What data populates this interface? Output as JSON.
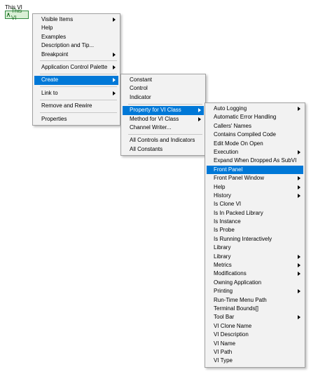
{
  "vi": {
    "label": "This VI",
    "constant_text": "This VI"
  },
  "context_menu": {
    "items": [
      {
        "label": "Visible Items",
        "submenu": true
      },
      {
        "label": "Help"
      },
      {
        "label": "Examples"
      },
      {
        "label": "Description and Tip..."
      },
      {
        "label": "Breakpoint",
        "submenu": true
      },
      {
        "label": "Application Control Palette",
        "submenu": true
      },
      {
        "label": "Create",
        "submenu": true,
        "selected": true
      },
      {
        "label": "Link to",
        "submenu": true
      },
      {
        "label": "Remove and Rewire"
      },
      {
        "label": "Properties"
      }
    ]
  },
  "create_menu": {
    "items": [
      {
        "label": "Constant"
      },
      {
        "label": "Control"
      },
      {
        "label": "Indicator"
      },
      {
        "label": "Property for VI Class",
        "submenu": true,
        "selected": true
      },
      {
        "label": "Method for VI Class",
        "submenu": true
      },
      {
        "label": "Channel Writer..."
      },
      {
        "label": "All Controls and Indicators"
      },
      {
        "label": "All Constants"
      }
    ]
  },
  "property_menu": {
    "items": [
      {
        "label": "Auto Logging",
        "submenu": true
      },
      {
        "label": "Automatic Error Handling"
      },
      {
        "label": "Callers' Names"
      },
      {
        "label": "Contains Compiled Code"
      },
      {
        "label": "Edit Mode On Open"
      },
      {
        "label": "Execution",
        "submenu": true
      },
      {
        "label": "Expand When Dropped As SubVI"
      },
      {
        "label": "Front Panel",
        "selected": true
      },
      {
        "label": "Front Panel Window",
        "submenu": true
      },
      {
        "label": "Help",
        "submenu": true
      },
      {
        "label": "History",
        "submenu": true
      },
      {
        "label": "Is Clone VI"
      },
      {
        "label": "Is In Packed Library"
      },
      {
        "label": "Is Instance"
      },
      {
        "label": "Is Probe"
      },
      {
        "label": "Is Running Interactively"
      },
      {
        "label": "Library"
      },
      {
        "label": "Library",
        "submenu": true
      },
      {
        "label": "Metrics",
        "submenu": true
      },
      {
        "label": "Modifications",
        "submenu": true
      },
      {
        "label": "Owning Application"
      },
      {
        "label": "Printing",
        "submenu": true
      },
      {
        "label": "Run-Time Menu Path"
      },
      {
        "label": "Terminal Bounds[]"
      },
      {
        "label": "Tool Bar",
        "submenu": true
      },
      {
        "label": "VI Clone Name"
      },
      {
        "label": "VI Description"
      },
      {
        "label": "VI Name"
      },
      {
        "label": "VI Path"
      },
      {
        "label": "VI Type"
      }
    ]
  },
  "colors": {
    "selection": "#0078d7",
    "menu_background": "#f2f2f2",
    "constant_border": "#2f8a3f",
    "constant_fill": "#d9efd6"
  }
}
